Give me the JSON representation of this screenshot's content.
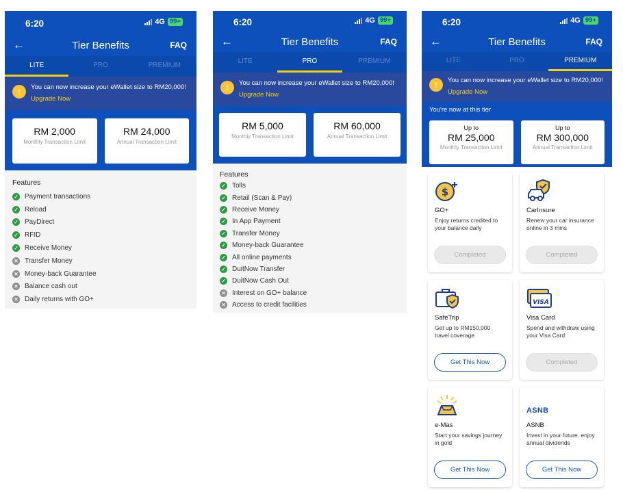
{
  "status": {
    "time": "6:20",
    "network": "4G",
    "battery": "99+"
  },
  "header": {
    "title": "Tier Benefits",
    "faq": "FAQ"
  },
  "tabs": [
    "LITE",
    "PRO",
    "PREMIUM"
  ],
  "banner": {
    "text": "You can now increase your eWallet size to RM20,000!",
    "link": "Upgrade Now"
  },
  "lite": {
    "monthly": {
      "amount": "RM 2,000",
      "label": "Monthly Transaction Limit"
    },
    "annual": {
      "amount": "RM 24,000",
      "label": "Annual Transaction Limit"
    },
    "features_title": "Features",
    "features": [
      {
        "label": "Payment transactions",
        "enabled": true
      },
      {
        "label": "Reload",
        "enabled": true
      },
      {
        "label": "PayDirect",
        "enabled": true
      },
      {
        "label": "RFID",
        "enabled": true
      },
      {
        "label": "Receive Money",
        "enabled": true
      },
      {
        "label": "Transfer Money",
        "enabled": false
      },
      {
        "label": "Money-back Guarantee",
        "enabled": false
      },
      {
        "label": "Balance cash out",
        "enabled": false
      },
      {
        "label": "Daily returns with GO+",
        "enabled": false
      }
    ]
  },
  "pro": {
    "monthly": {
      "amount": "RM 5,000",
      "label": "Monthly Transaction Limit"
    },
    "annual": {
      "amount": "RM 60,000",
      "label": "Annual Transaction Limit"
    },
    "features_title": "Features",
    "features": [
      {
        "label": "Tolls",
        "enabled": true
      },
      {
        "label": "Retail (Scan & Pay)",
        "enabled": true
      },
      {
        "label": "Receive Money",
        "enabled": true
      },
      {
        "label": "In App Payment",
        "enabled": true
      },
      {
        "label": "Transfer Money",
        "enabled": true
      },
      {
        "label": "Money-back Guarantee",
        "enabled": true
      },
      {
        "label": "All online payments",
        "enabled": true
      },
      {
        "label": "DuitNow Transfer",
        "enabled": true
      },
      {
        "label": "DuitNow Cash Out",
        "enabled": true
      },
      {
        "label": "Interest on GO+ balance",
        "enabled": false
      },
      {
        "label": "Access to credit facilities",
        "enabled": false
      }
    ]
  },
  "premium": {
    "tier_note": "You're now at this tier",
    "monthly": {
      "prefix": "Up to",
      "amount": "RM 25,000",
      "label": "Monthly Transaction Limit"
    },
    "annual": {
      "prefix": "Up to",
      "amount": "RM 300,000",
      "label": "Annual Transaction Limit"
    },
    "cards": [
      {
        "icon": "gold-coin-icon",
        "name": "GO+",
        "desc": "Enjoy returns credited to your balance daily",
        "button": "Completed",
        "completed": true
      },
      {
        "icon": "car-shield-icon",
        "name": "CarInsure",
        "desc": "Renew your car insurance online in 3 mins",
        "button": "Completed",
        "completed": true
      },
      {
        "icon": "suitcase-shield-icon",
        "name": "SafeTrip",
        "desc": "Get up to RM150,000 travel coverage",
        "button": "Get This Now",
        "completed": false
      },
      {
        "icon": "visa-card-icon",
        "name": "Visa Card",
        "desc": "Spend and withdraw using your Visa Card",
        "button": "Completed",
        "completed": true
      },
      {
        "icon": "gold-bar-icon",
        "name": "e-Mas",
        "desc": "Start your savings journey in gold",
        "button": "Get This Now",
        "completed": false
      },
      {
        "icon": "asnb-logo",
        "logo_text": "ASNB",
        "name": "ASNB",
        "desc": "Invest in your future, enjoy annual dividends",
        "button": "Get This Now",
        "completed": false
      }
    ]
  },
  "colors": {
    "primary": "#0d4fbb",
    "banner": "#29499f",
    "accent": "#f5d10c",
    "success": "#2f9c45",
    "disabled": "#8d8d8d"
  }
}
